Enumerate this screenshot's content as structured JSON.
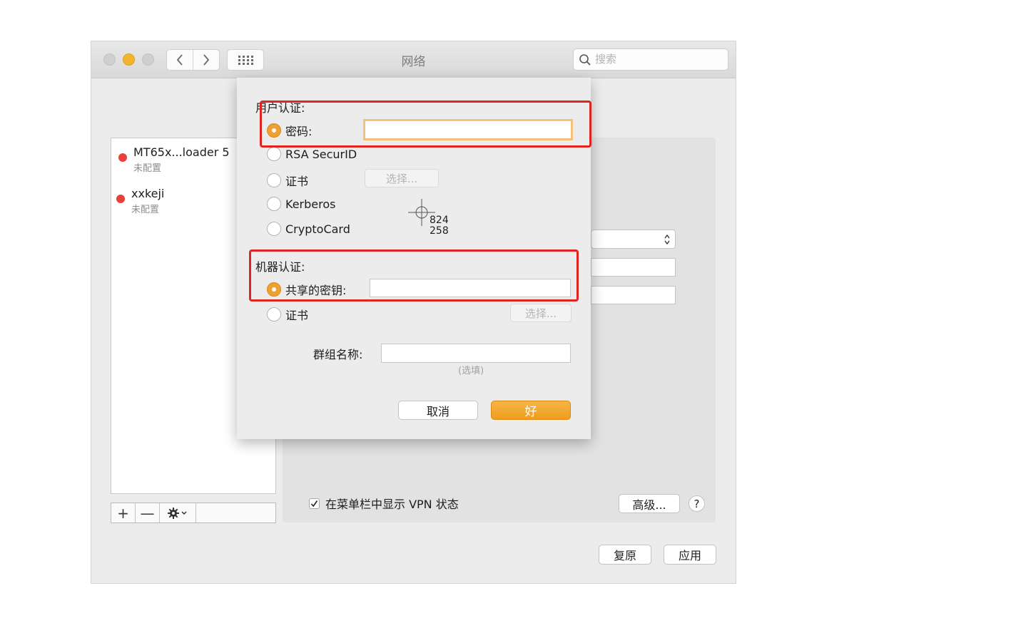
{
  "window": {
    "title": "网络"
  },
  "search": {
    "placeholder": "搜索"
  },
  "services": [
    {
      "name": "MT65x...loader 5",
      "status": "未配置"
    },
    {
      "name": "xxkeji",
      "status": "未配置"
    }
  ],
  "list_toolbar": {
    "add": "+",
    "remove": "—"
  },
  "vpn_checkbox": {
    "label": "在菜单栏中显示 VPN 状态",
    "checked": true
  },
  "buttons": {
    "advanced": "高级...",
    "help": "?",
    "revert": "复原",
    "apply": "应用"
  },
  "sheet": {
    "user_auth": {
      "title": "用户认证:",
      "options": [
        "密码:",
        "RSA SecurID",
        "证书",
        "Kerberos",
        "CryptoCard"
      ],
      "selected": "密码:",
      "cert_choose": "选择..."
    },
    "machine_auth": {
      "title": "机器认证:",
      "options": [
        "共享的密钥:",
        "证书"
      ],
      "selected": "共享的密钥:",
      "cert_choose": "选择..."
    },
    "group_name": {
      "label": "群组名称:",
      "hint": "(选填)"
    },
    "cancel": "取消",
    "ok": "好"
  },
  "cursor_readout": {
    "x": "824",
    "y": "258"
  },
  "colors": {
    "accent": "#f0a030",
    "annotation": "#e02420",
    "status_red": "#e8403a"
  },
  "icons": [
    "search-icon",
    "chevron-left-icon",
    "chevron-right-icon",
    "grid-icon",
    "gear-icon",
    "chevron-down-icon",
    "checkmark-icon",
    "crosshair-icon"
  ]
}
